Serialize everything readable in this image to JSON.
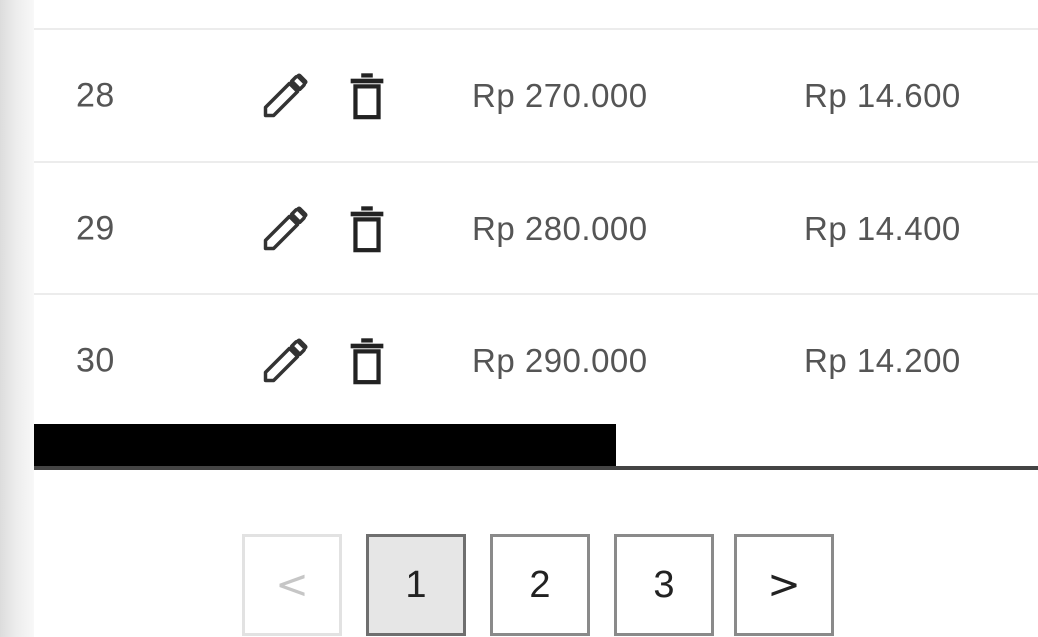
{
  "table": {
    "rows": [
      {
        "no": "28",
        "price": "Rp 270.000",
        "price2": "Rp 14.600"
      },
      {
        "no": "29",
        "price": "Rp 280.000",
        "price2": "Rp 14.400"
      },
      {
        "no": "30",
        "price": "Rp 290.000",
        "price2": "Rp 14.200"
      }
    ],
    "row_actions": {
      "edit_icon": "pencil-icon",
      "delete_icon": "trash-icon"
    }
  },
  "scrollbar": {
    "position": 0.0,
    "visible_fraction": 0.58
  },
  "pagination": {
    "prev_label": "<",
    "pages": [
      "1",
      "2",
      "3"
    ],
    "next_label": ">",
    "current_page": "1",
    "prev_disabled": true
  },
  "colors": {
    "text": "#555555",
    "divider": "#ececec",
    "scroll_thumb": "#000000",
    "active_page_bg": "#e6e6e6"
  }
}
